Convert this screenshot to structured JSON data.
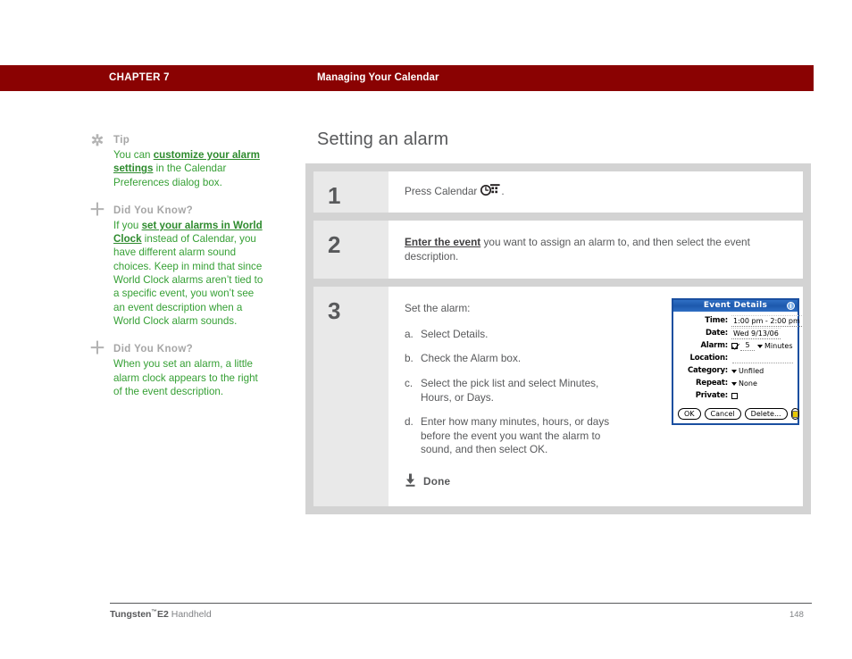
{
  "header": {
    "chapter": "CHAPTER 7",
    "title": "Managing Your Calendar",
    "bar_color": "#8a0202"
  },
  "sidebar": {
    "tips": [
      {
        "marker": "asterisk-icon",
        "marker_glyph": "✲",
        "heading": "Tip",
        "text_before": "You can ",
        "link": "customize your alarm settings",
        "text_after": " in the Calendar Preferences dialog box."
      },
      {
        "marker": "plus-icon",
        "marker_glyph": "＋",
        "heading": "Did You Know?",
        "text_before": "If you ",
        "link": "set your alarms in World Clock",
        "text_after": " instead of Calendar, you have different alarm sound choices. Keep in mind that since World Clock alarms aren’t tied to a specific event, you won’t see an event description when a World Clock alarm sounds."
      },
      {
        "marker": "plus-icon",
        "marker_glyph": "＋",
        "heading": "Did You Know?",
        "text_before": "When you set an alarm, a little alarm clock appears to the right of the event description.",
        "link": "",
        "text_after": ""
      }
    ],
    "link_color": "#2e8b2e",
    "body_color": "#36a035",
    "heading_color": "#a6a6a6"
  },
  "main": {
    "title": "Setting an alarm",
    "steps": [
      {
        "number": "1",
        "text_before": "Press Calendar ",
        "icon": "calendar-app-icon",
        "text_after": "."
      },
      {
        "number": "2",
        "link": "Enter the event",
        "text_after": " you want to assign an alarm to, and then select the event description."
      },
      {
        "number": "3",
        "intro": "Set the alarm:",
        "substeps": [
          {
            "letter": "a.",
            "text": "Select Details."
          },
          {
            "letter": "b.",
            "text": "Check the Alarm box."
          },
          {
            "letter": "c.",
            "text": "Select the pick list and select Minutes, Hours, or Days."
          },
          {
            "letter": "d.",
            "text": "Enter how many minutes, hours, or days before the event you want the alarm to sound, and then select OK."
          }
        ],
        "done_label": "Done",
        "done_icon": "download-arrow-icon"
      }
    ]
  },
  "dialog": {
    "title": "Event Details",
    "info_glyph": "i",
    "fields": {
      "time_label": "Time:",
      "time_value": "1:00 pm - 2:00 pm",
      "date_label": "Date:",
      "date_value": "Wed 9/13/06",
      "alarm_label": "Alarm:",
      "alarm_checked": "checked",
      "alarm_amount": "5",
      "alarm_unit": "Minutes",
      "location_label": "Location:",
      "location_value": "",
      "category_label": "Category:",
      "category_value": "Unfiled",
      "repeat_label": "Repeat:",
      "repeat_value": "None",
      "private_label": "Private:"
    },
    "buttons": {
      "ok": "OK",
      "cancel": "Cancel",
      "delete": "Delete...",
      "note": "note-icon"
    },
    "title_color": "#1d59ad"
  },
  "footer": {
    "product": "Tungsten",
    "trademark": "™",
    "model": "E2",
    "kind": "Handheld",
    "page": "148"
  }
}
